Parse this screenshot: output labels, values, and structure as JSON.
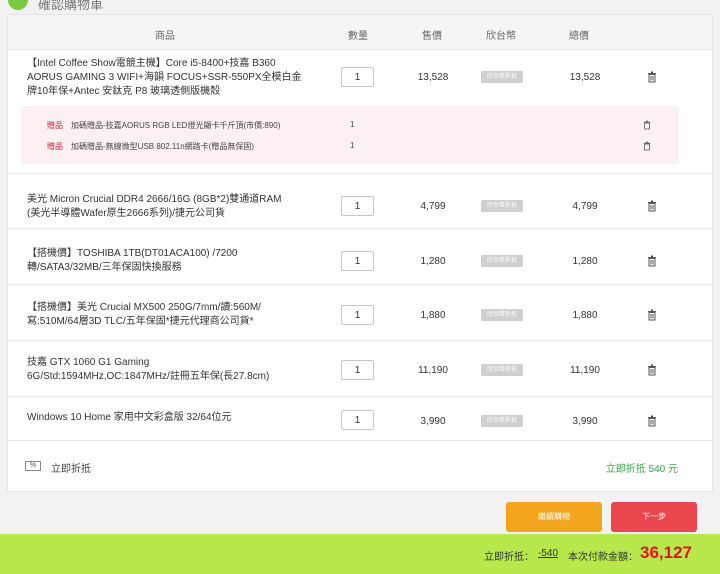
{
  "header": {
    "step_title": "確認購物車"
  },
  "table": {
    "columns": [
      "商品",
      "數量",
      "售價",
      "欣台幣",
      "總價"
    ]
  },
  "items": [
    {
      "name_lines": [
        "【Intel Coffee Show電競主機】Core i5-8400+技嘉 B360",
        "AORUS GAMING 3 WIFI+海韻 FOCUS+SSR-550PX全模白金",
        "牌10年保+Antec 安鈦克 P8 玻璃透側版機殼"
      ],
      "qty": "1",
      "price": "13,528",
      "badge": "欣台幣折抵",
      "total": "13,528"
    },
    {
      "name_lines": [
        "美光 Micron Crucial DDR4 2666/16G (8GB*2)雙通道RAM",
        "(美光半導體Wafer原生2666系列)/捷元公司貨"
      ],
      "qty": "1",
      "price": "4,799",
      "badge": "欣台幣折抵",
      "total": "4,799"
    },
    {
      "name_lines": [
        "【搭機價】TOSHIBA 1TB(DT01ACA100) /7200",
        "轉/SATA3/32MB/三年保固快換服務"
      ],
      "qty": "1",
      "price": "1,280",
      "badge": "欣台幣折抵",
      "total": "1,280"
    },
    {
      "name_lines": [
        "【搭機價】美光 Crucial MX500 250G/7mm/讀:560M/",
        "寫:510M/64層3D TLC/五年保固*捷元代理商公司貨*"
      ],
      "qty": "1",
      "price": "1,880",
      "badge": "欣台幣折抵",
      "total": "1,880"
    },
    {
      "name_lines": [
        "技嘉 GTX 1060 G1 Gaming",
        "6G/Std:1594MHz,OC:1847MHz/註冊五年保(長27.8cm)"
      ],
      "qty": "1",
      "price": "11,190",
      "badge": "欣台幣折抵",
      "total": "11,190"
    },
    {
      "name_lines": [
        "Windows 10 Home 家用中文彩盒版 32/64位元"
      ],
      "qty": "1",
      "price": "3,990",
      "badge": "欣台幣折抵",
      "total": "3,990"
    }
  ],
  "gifts": [
    {
      "tag": "贈品",
      "name": "加碼贈品-技嘉AORUS RGB LED燈光顯卡千斤頂(市價:890)",
      "qty": "1"
    },
    {
      "tag": "贈品",
      "name": "加碼贈品-無線微型USB 802.11n網路卡(贈品無保固)",
      "qty": "1"
    }
  ],
  "discount": {
    "icon_text": "%",
    "label": "立即折抵",
    "right_text": "立即折抵 540 元"
  },
  "buttons": {
    "continue": "繼續購物",
    "next": "下一步"
  },
  "footer": {
    "discount_label": "立即折抵：",
    "discount_value": "-540",
    "total_label": "本次付款金額：",
    "total_value": "36,127"
  }
}
